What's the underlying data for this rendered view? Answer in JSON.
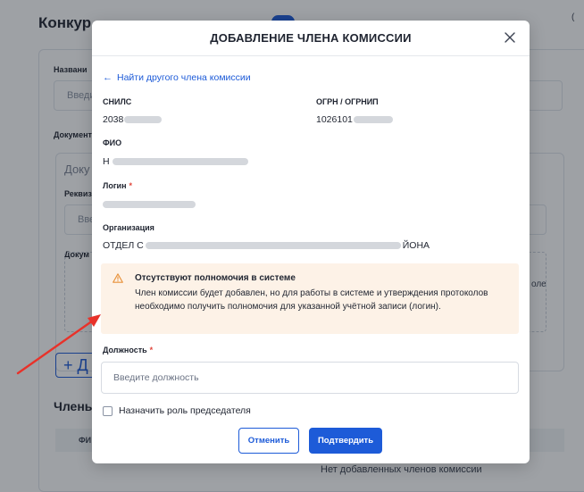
{
  "background": {
    "page_title": "Конкур",
    "name_label": "Названи",
    "name_placeholder": "Введи",
    "docs_label": "Документ",
    "subcard_title": "Доку",
    "requisites_label": "Реквиз",
    "requisites_placeholder": "Вве",
    "doc_label": "Докум",
    "side_text": "оле",
    "add_button": "+ Д",
    "members_section": "Члены",
    "table_header": "ФИ",
    "empty_text": "Нет добавленных членов комиссии",
    "corner_text": "("
  },
  "modal": {
    "title": "ДОБАВЛЕНИЕ ЧЛЕНА КОМИССИИ",
    "back_link": "Найти другого члена комиссии",
    "snils_label": "СНИЛС",
    "snils_value": "2038",
    "ogrn_label": "ОГРН / ОГРНИП",
    "ogrn_value": "1026101",
    "fio_label": "ФИО",
    "fio_value": "Н",
    "login_label": "Логин",
    "login_value": "",
    "org_label": "Организация",
    "org_value_start": "ОТДЕЛ С",
    "org_value_end": "ЙОНА",
    "required_mark": "*",
    "alert_title": "Отсутствуют полномочия в системе",
    "alert_text": "Член комиссии будет добавлен, но для работы в системе и утверждения протоколов необходимо получить полномочия для указанной учётной записи (логин).",
    "position_label": "Должность",
    "position_placeholder": "Введите должность",
    "position_value": "",
    "chairman_label": "Назначить роль председателя",
    "chairman_checked": false,
    "cancel_label": "Отменить",
    "confirm_label": "Подтвердить"
  },
  "icons": {
    "back": "arrow-left-icon",
    "close": "close-icon",
    "warning": "warning-triangle-icon"
  },
  "colors": {
    "accent": "#1d5bd8",
    "alert_bg": "#fdf2e7",
    "warning": "#e8913a",
    "required": "#e0453a",
    "annotation_arrow": "#e8322a"
  }
}
